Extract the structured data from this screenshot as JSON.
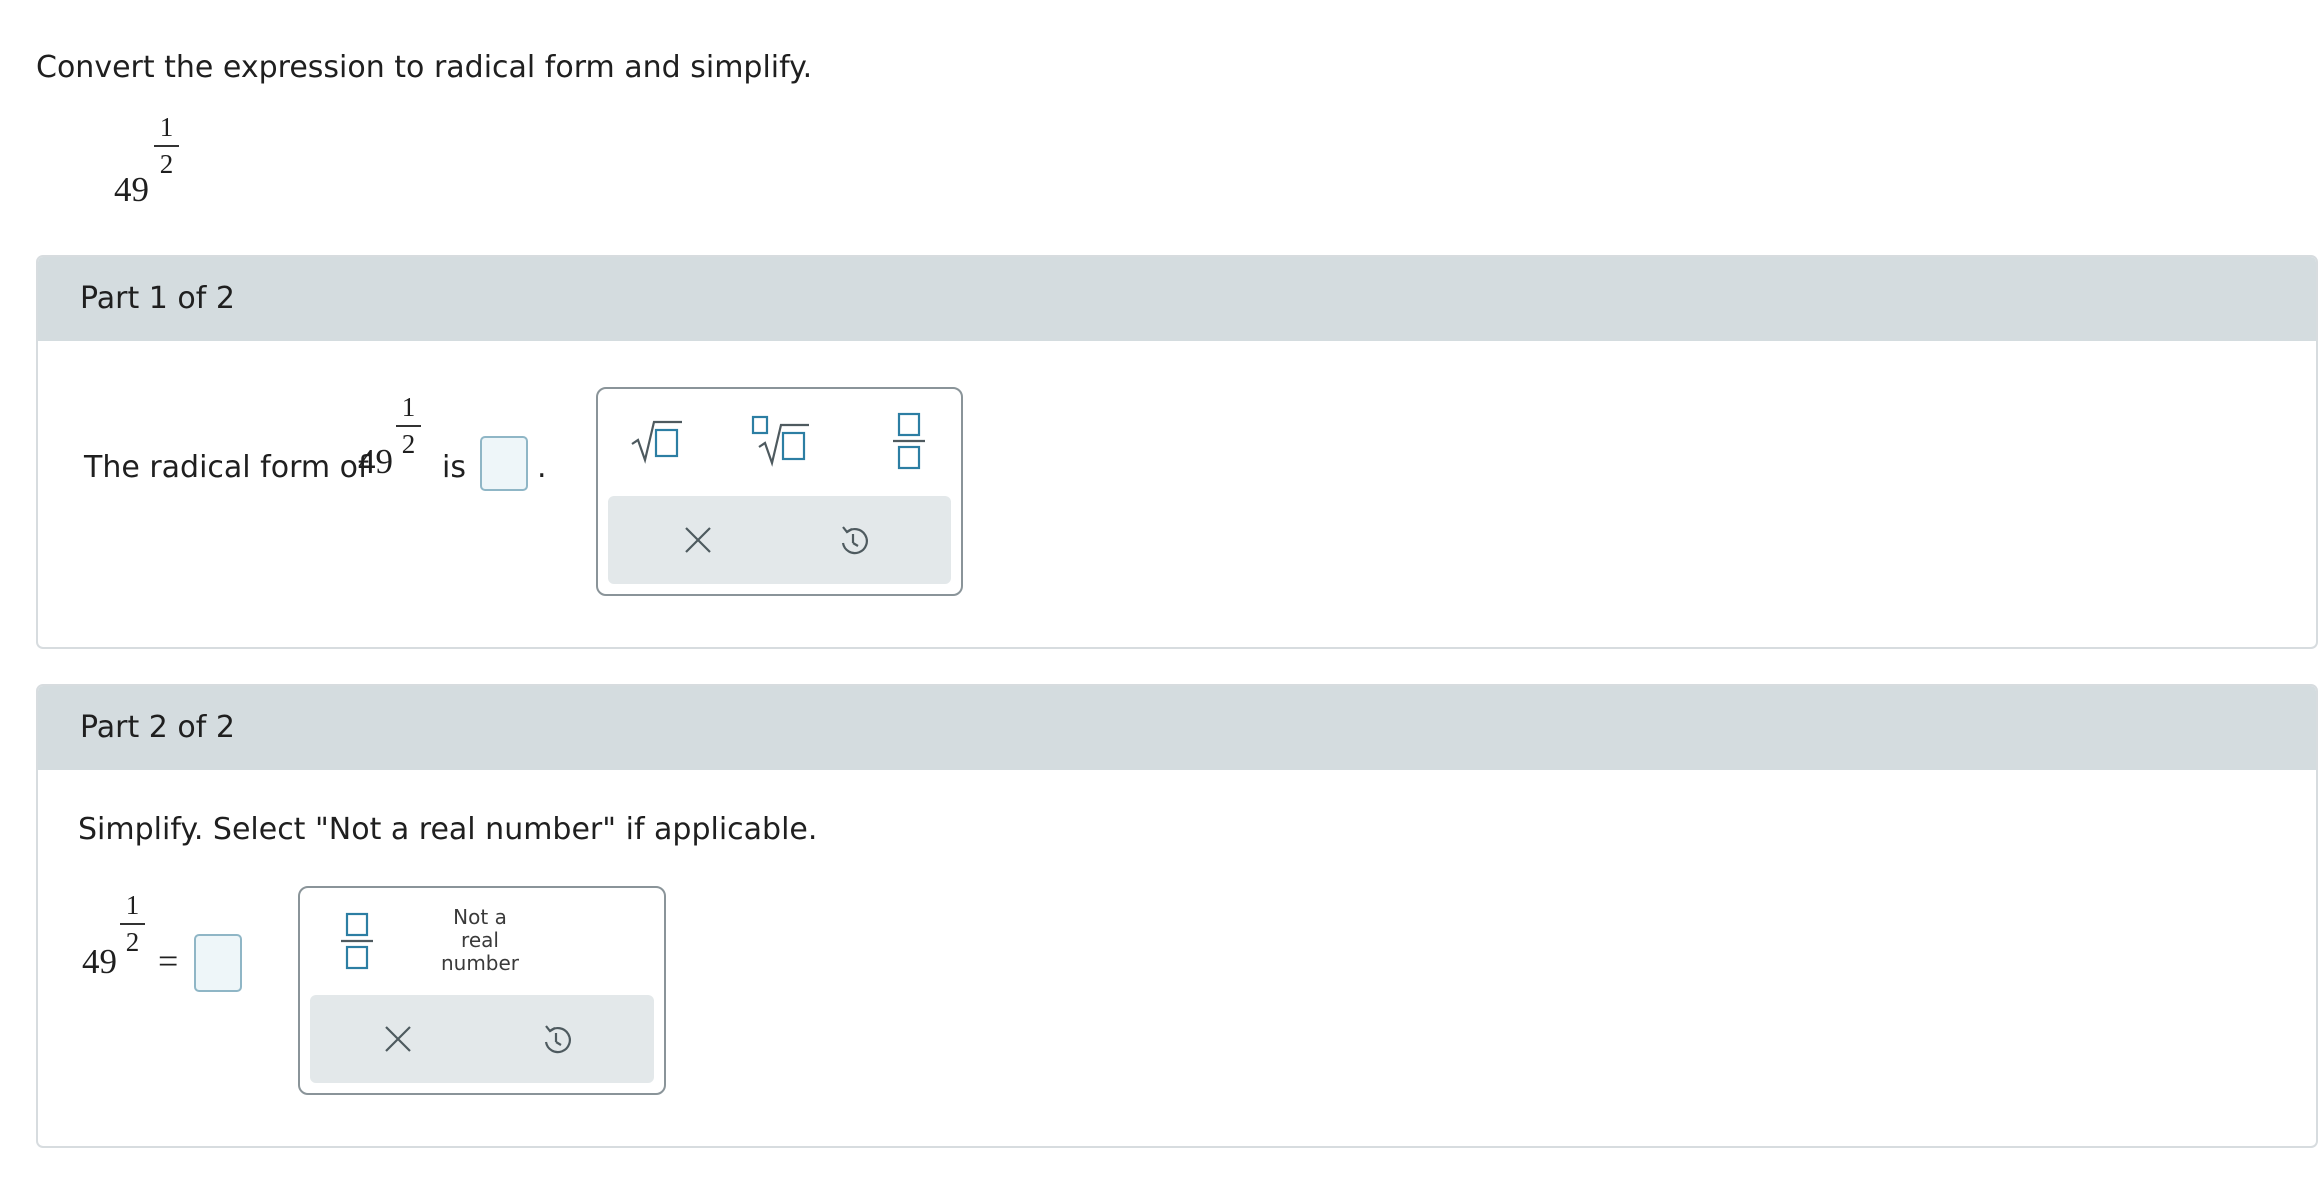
{
  "problem": {
    "prompt": "Convert the expression to radical form and simplify.",
    "base": "49",
    "exp_num": "1",
    "exp_den": "2"
  },
  "part1": {
    "header": "Part 1 of 2",
    "sentence_prefix": "The radical form of",
    "base": "49",
    "exp_num": "1",
    "exp_den": "2",
    "sentence_is": "is",
    "period": ".",
    "palette": {
      "buttons": [
        "square-root",
        "nth-root",
        "fraction"
      ],
      "clear_icon": "times-icon",
      "undo_icon": "undo-icon"
    }
  },
  "part2": {
    "header": "Part 2 of 2",
    "instruction": "Simplify. Select \"Not a real number\" if applicable.",
    "base": "49",
    "exp_num": "1",
    "exp_den": "2",
    "equals": "=",
    "palette": {
      "not_real_line1": "Not a",
      "not_real_line2": "real",
      "not_real_line3": "number",
      "clear_icon": "times-icon",
      "undo_icon": "undo-icon"
    }
  },
  "colors": {
    "header_bg": "#d4dcdf",
    "answer_box_border": "#8fb6c6",
    "icon_accent": "#2c7ea3"
  }
}
